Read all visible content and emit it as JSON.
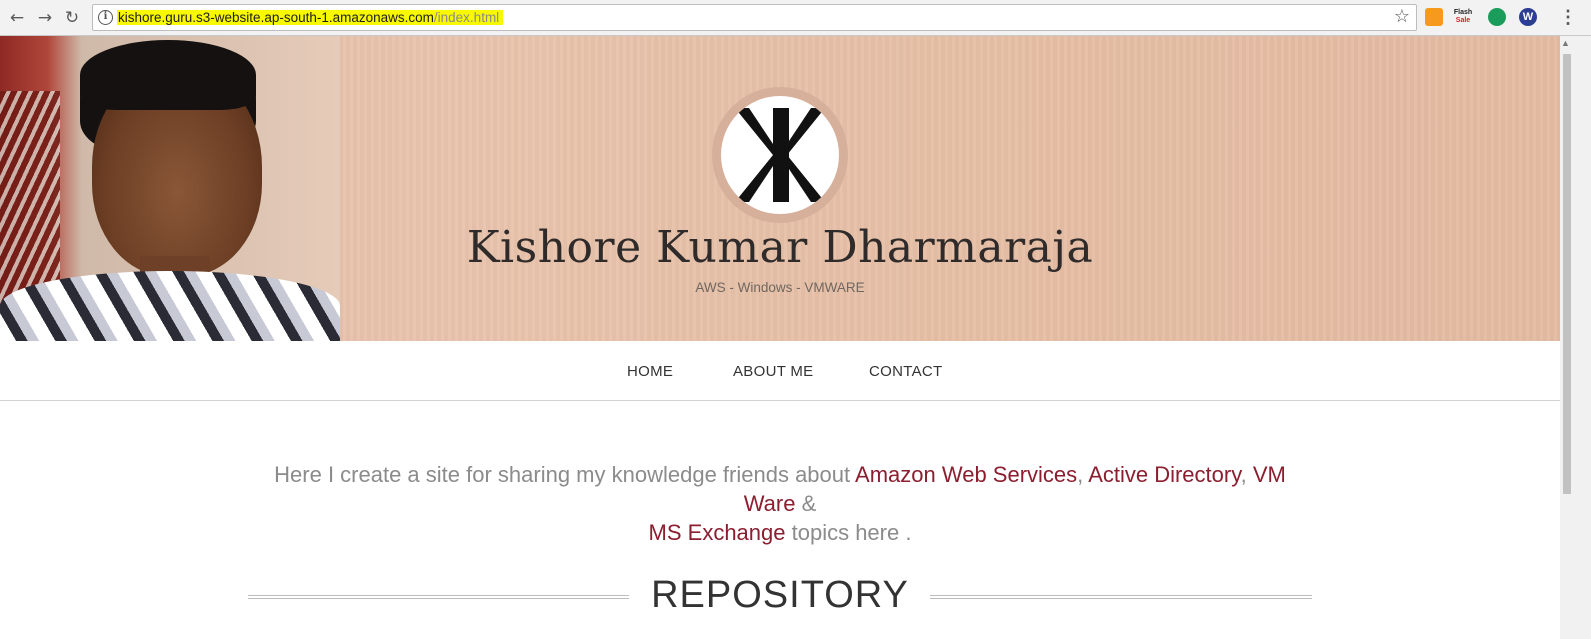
{
  "browser": {
    "url_host": "kishore.guru.s3-website.ap-south-1.amazonaws.com",
    "url_path": "/index.html",
    "back_glyph": "←",
    "forward_glyph": "→",
    "reload_glyph": "↻",
    "star_glyph": "☆",
    "menu_glyph": "⋮",
    "extensions": [
      {
        "name": "orange-extension-icon",
        "label": ""
      },
      {
        "name": "flash-sale-extension-icon",
        "label": "Flash",
        "sub": "Sale"
      },
      {
        "name": "green-cart-extension-icon",
        "label": ""
      },
      {
        "name": "w-extension-icon",
        "label": "W"
      }
    ]
  },
  "hero": {
    "title": "Kishore Kumar Dharmaraja",
    "subtitle": "AWS - Windows - VMWARE"
  },
  "nav": {
    "items": [
      "HOME",
      "ABOUT ME",
      "CONTACT"
    ]
  },
  "intro": {
    "lead": "Here I create a site for sharing my knowledge friends about ",
    "link1": "Amazon Web Services",
    "sep1": ", ",
    "link2": "Active Directory",
    "sep2": ", ",
    "link3": "VM Ware",
    "sep3": " & ",
    "link4": "MS Exchange",
    "tail": " topics here ."
  },
  "section": {
    "title": "REPOSITORY"
  },
  "colors": {
    "link": "#8b1e2f",
    "hero_bg": "#e6bfa6",
    "url_highlight": "#f8f800"
  }
}
